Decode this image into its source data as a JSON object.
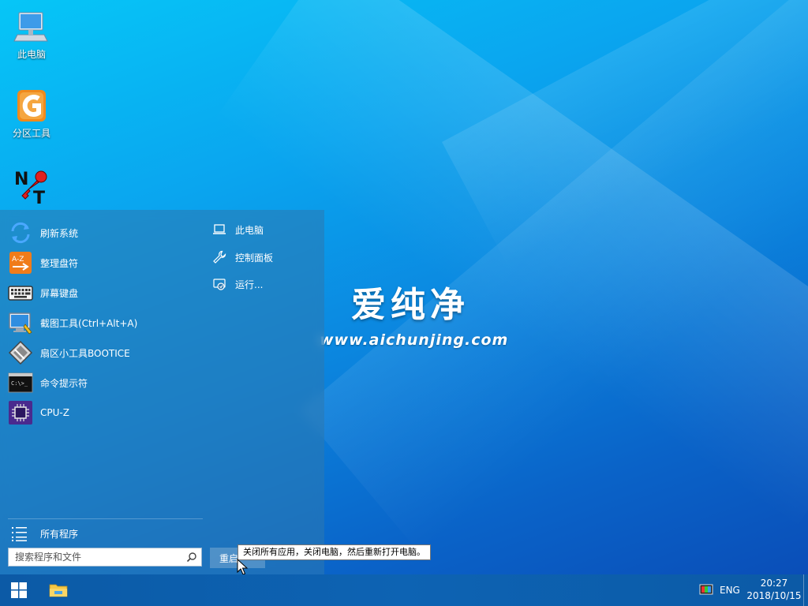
{
  "desktop": {
    "icons": [
      {
        "label": "此电脑",
        "icon": "computer-icon"
      },
      {
        "label": "分区工具",
        "icon": "diskgenius-icon"
      },
      {
        "label": "",
        "icon": "nt-password-icon"
      }
    ],
    "brand": {
      "title": "爱纯净",
      "url": "www.aichunjing.com"
    }
  },
  "start_menu": {
    "apps": [
      {
        "label": "刷新系统",
        "icon": "refresh-icon"
      },
      {
        "label": "整理盘符",
        "icon": "sort-drive-icon"
      },
      {
        "label": "屏幕键盘",
        "icon": "keyboard-icon"
      },
      {
        "label": "截图工具(Ctrl+Alt+A)",
        "icon": "screenshot-icon"
      },
      {
        "label": "扇区小工具BOOTICE",
        "icon": "bootice-icon"
      },
      {
        "label": "命令提示符",
        "icon": "cmd-icon"
      },
      {
        "label": "CPU-Z",
        "icon": "cpu-z-icon"
      }
    ],
    "all_programs": "所有程序",
    "search": {
      "placeholder": "搜索程序和文件"
    },
    "places": [
      {
        "label": "此电脑",
        "icon": "laptop-icon"
      },
      {
        "label": "控制面板",
        "icon": "wrench-icon"
      },
      {
        "label": "运行...",
        "icon": "run-icon"
      }
    ],
    "restart_label": "重启",
    "tooltip": "关闭所有应用，关闭电脑，然后重新打开电脑。"
  },
  "taskbar": {
    "lang": "ENG",
    "time": "20:27",
    "date": "2018/10/15"
  },
  "colors": {
    "accent": "#0c5aa6",
    "desktop": "#0a86df"
  }
}
